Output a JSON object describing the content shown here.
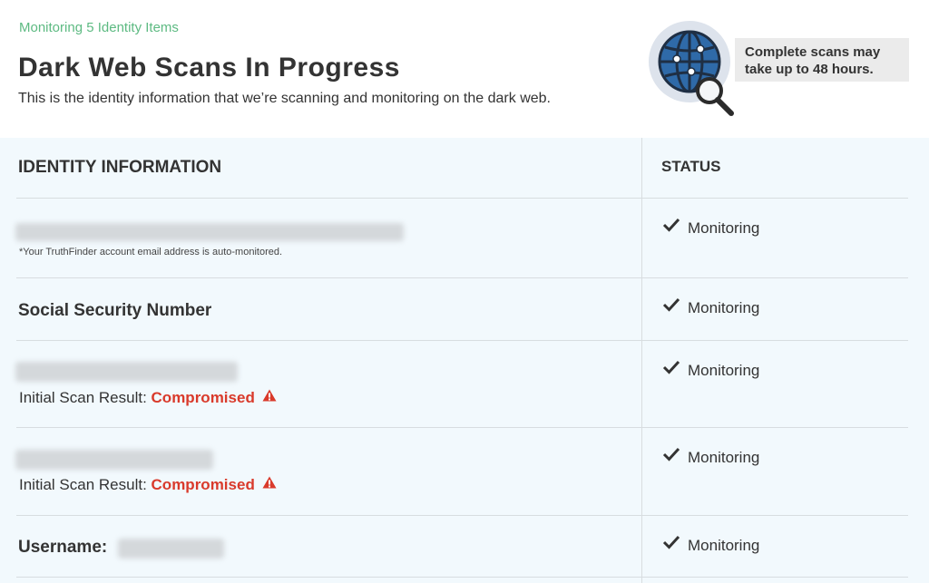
{
  "header": {
    "eyebrow": "Monitoring 5 Identity Items",
    "title": "Dark Web Scans In Progress",
    "subtitle": "This is the identity information that we’re scanning and monitoring on the dark web.",
    "note_line1": "Complete scans may",
    "note_line2": "take up to 48 hours.",
    "globe_icon": "globe-magnifier-icon"
  },
  "table": {
    "col_identity": "IDENTITY INFORMATION",
    "col_status": "STATUS",
    "rows": [
      {
        "email_note": "*Your TruthFinder account email address is auto-monitored.",
        "status": "Monitoring"
      },
      {
        "label": "Social Security Number",
        "status": "Monitoring"
      },
      {
        "scan_prefix": "Initial Scan Result:",
        "scan_result": "Compromised",
        "status": "Monitoring"
      },
      {
        "scan_prefix": "Initial Scan Result:",
        "scan_result": "Compromised",
        "status": "Monitoring"
      },
      {
        "label": "Username:",
        "status": "Monitoring"
      }
    ]
  },
  "colors": {
    "accent_green": "#5dba82",
    "compromised_red": "#d93a2b",
    "table_bg": "#f2f9fd",
    "globe_blue": "#2f6aa8"
  }
}
